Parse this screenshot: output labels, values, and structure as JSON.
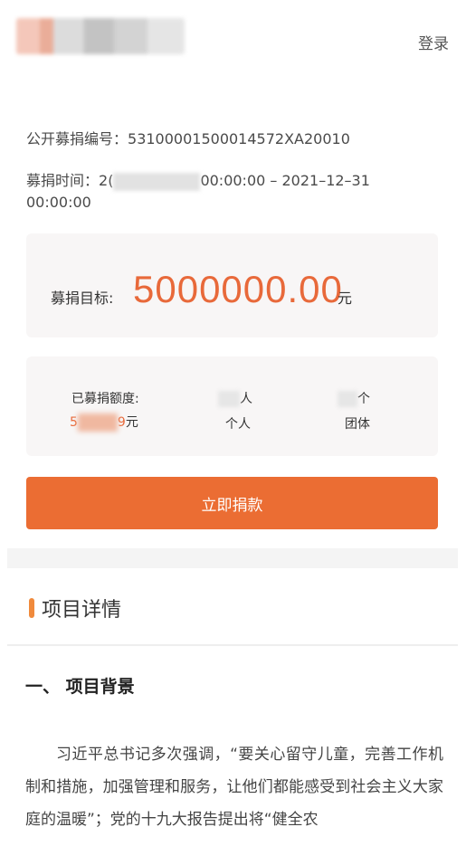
{
  "header": {
    "login_label": "登录"
  },
  "info": {
    "code_label": "公开募捐编号：",
    "code_value": "53100001500014572XA20010",
    "time_label": "募捐时间：",
    "time_start_visible": "2(",
    "time_mid_visible": "00:00:00 – 2021–12–31",
    "time_line2": "00:00:00"
  },
  "goal": {
    "label": "募捐目标:",
    "amount": "5000000.00",
    "unit": "元"
  },
  "stats": {
    "raised_label": "已募捐额度:",
    "raised_visible_prefix": "5",
    "raised_visible_suffix": "9",
    "raised_unit": "元",
    "persons_unit": "人",
    "persons_label": "个人",
    "groups_unit": "个",
    "groups_label": "团体"
  },
  "donate_button": "立即捐款",
  "details": {
    "section_title": "项目详情",
    "subsection_title": "一、 项目背景",
    "paragraph": "习近平总书记多次强调，“要关心留守儿童，完善工作机制和措施，加强管理和服务，让他们都能感受到社会主义大家庭的温暖”；党的十九大报告提出将“健全农"
  },
  "colors": {
    "accent": "#eb6d33",
    "amount": "#e8693a",
    "card_bg": "#f8f6f6",
    "title_bar": "#f08a3c"
  },
  "icons": {
    "section_marker": "vertical-bar-icon"
  }
}
